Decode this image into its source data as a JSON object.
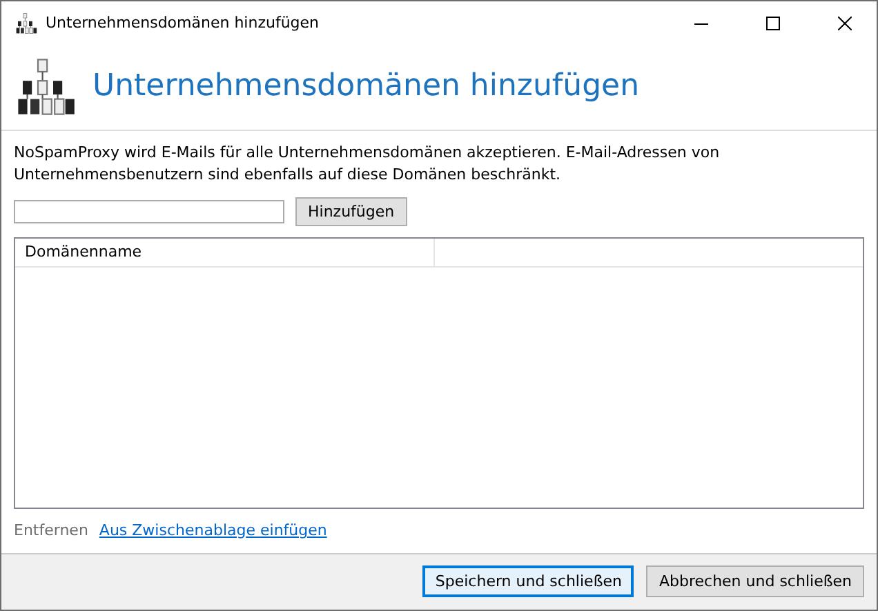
{
  "window": {
    "title": "Unternehmensdomänen hinzufügen"
  },
  "header": {
    "title": "Unternehmensdomänen hinzufügen"
  },
  "description": "NoSpamProxy wird E-Mails für alle Unternehmensdomänen akzeptieren. E-Mail-Adressen von Unternehmensbenutzern sind ebenfalls auf diese Domänen beschränkt.",
  "add_row": {
    "button": "Hinzufügen"
  },
  "table": {
    "columns": [
      "Domänenname"
    ]
  },
  "links": [
    {
      "label": "Entfernen",
      "disabled": true
    },
    {
      "label": "Aus Zwischenablage einfügen",
      "disabled": false
    }
  ],
  "buttons": [
    {
      "label": "Speichern und schließen",
      "default": true
    },
    {
      "label": "Abbrechen und schließen",
      "default": false
    }
  ]
}
